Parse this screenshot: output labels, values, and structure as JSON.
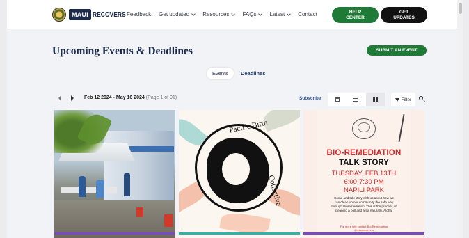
{
  "header": {
    "logo_text": "RECOVERS",
    "logo_mark": "MAUI",
    "nav": [
      {
        "label": "Feedback",
        "has_dropdown": false
      },
      {
        "label": "Get updated",
        "has_dropdown": true
      },
      {
        "label": "Resources",
        "has_dropdown": true
      },
      {
        "label": "FAQs",
        "has_dropdown": true
      },
      {
        "label": "Latest",
        "has_dropdown": true
      },
      {
        "label": "Contact",
        "has_dropdown": false
      }
    ],
    "help_button": {
      "line1": "HELP",
      "line2": "CENTER"
    },
    "updates_button": {
      "line1": "GET",
      "line2": "UPDATES"
    }
  },
  "main": {
    "title": "Upcoming Events & Deadlines",
    "submit_button": "SUBMIT AN EVENT",
    "tabs": [
      {
        "label": "Events",
        "active": true
      },
      {
        "label": "Deadlines",
        "active": false
      }
    ],
    "toolbar": {
      "date_range": "Feb 12 2024 - May 16 2024",
      "page_info": "(Page 1 of 91)",
      "subscribe": "Subscribe",
      "filter": "Filter"
    }
  },
  "cards": [
    {
      "bar_color": "#7b4ac2"
    },
    {
      "bar_color": "#2bb5a8",
      "graphic_text_top": "Pacific Birth",
      "graphic_text_right": "Collective"
    },
    {
      "bar_color": "#7b4ac2",
      "title1": "BIO-REMEDIATION",
      "title2": "TALK STORY",
      "date": "TUESDAY, FEB 13TH",
      "time": "6:00-7:30 PM",
      "place": "NAPILI PARK",
      "body": "Come and talk story with us about how we can clean up our community the safe way through Bioremediation. This is the process of cleaning a polluted area naturally. Aloha!",
      "footer": "For more info contact Bio-Remediation @mauirecovers"
    }
  ],
  "colors": {
    "brand_navy": "#1c2b4a",
    "brand_green": "#1e7a36",
    "link_blue": "#2a5aa8",
    "flyer_red": "#d12a2a"
  }
}
